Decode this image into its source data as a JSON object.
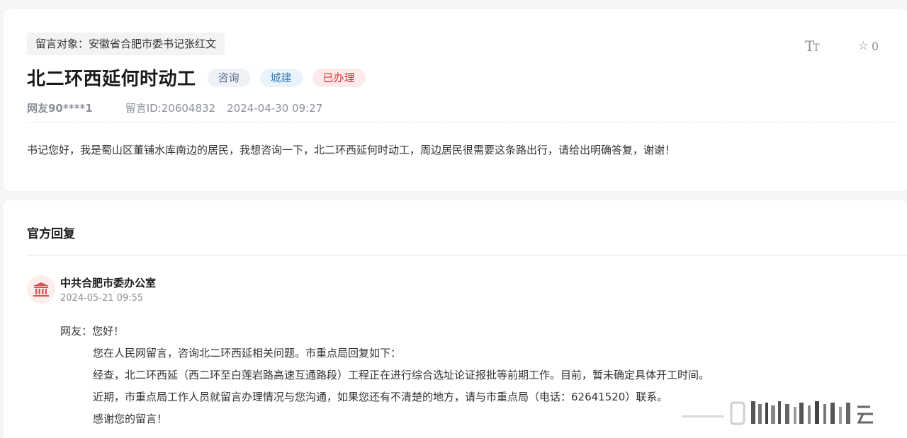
{
  "message": {
    "target": "留言对象：安徽省合肥市委书记张红文",
    "title": "北二环西延何时动工",
    "tags": [
      "咨询",
      "城建",
      "已办理"
    ],
    "user": "网友90****1",
    "message_id": "留言ID:20604832",
    "time": "2024-04-30 09:27",
    "content": "书记您好，我是蜀山区董铺水库南边的居民，我想咨询一下，北二环西延何时动工，周边居民很需要这条路出行，请给出明确答复，谢谢！"
  },
  "toolbar": {
    "font_size_label_big": "T",
    "font_size_label_small": "T",
    "favorite_count": "0",
    "favorite_icon": "star-outline-icon",
    "font_icon": "font-size-icon"
  },
  "reply_section": {
    "title": "官方回复",
    "org_name": "中共合肥市委办公室",
    "org_icon": "government-building-icon",
    "time": "2024-05-21 09:55",
    "greeting": "网友：您好！",
    "lines": [
      "您在人民网留言，咨询北二环西延相关问题。市重点局回复如下：",
      "经查，北二环西延（西二环至白莲岩路高速互通路段）工程正在进行综合选址论证报批等前期工作。目前，暂未确定具体开工时间。",
      "近期，市重点局工作人员就留言办理情况与您沟通，如果您还有不清楚的地方，请与市重点局（电话：62641520）联系。",
      "感谢您的留言！"
    ]
  },
  "colors": {
    "tag_consult_bg": "#eef1f6",
    "tag_city_bg": "#e9f4fa",
    "tag_done_bg": "#fdeaea",
    "tag_done_text": "#d9363e",
    "avatar_bg": "#fdeeee",
    "avatar_icon": "#d9534f"
  }
}
